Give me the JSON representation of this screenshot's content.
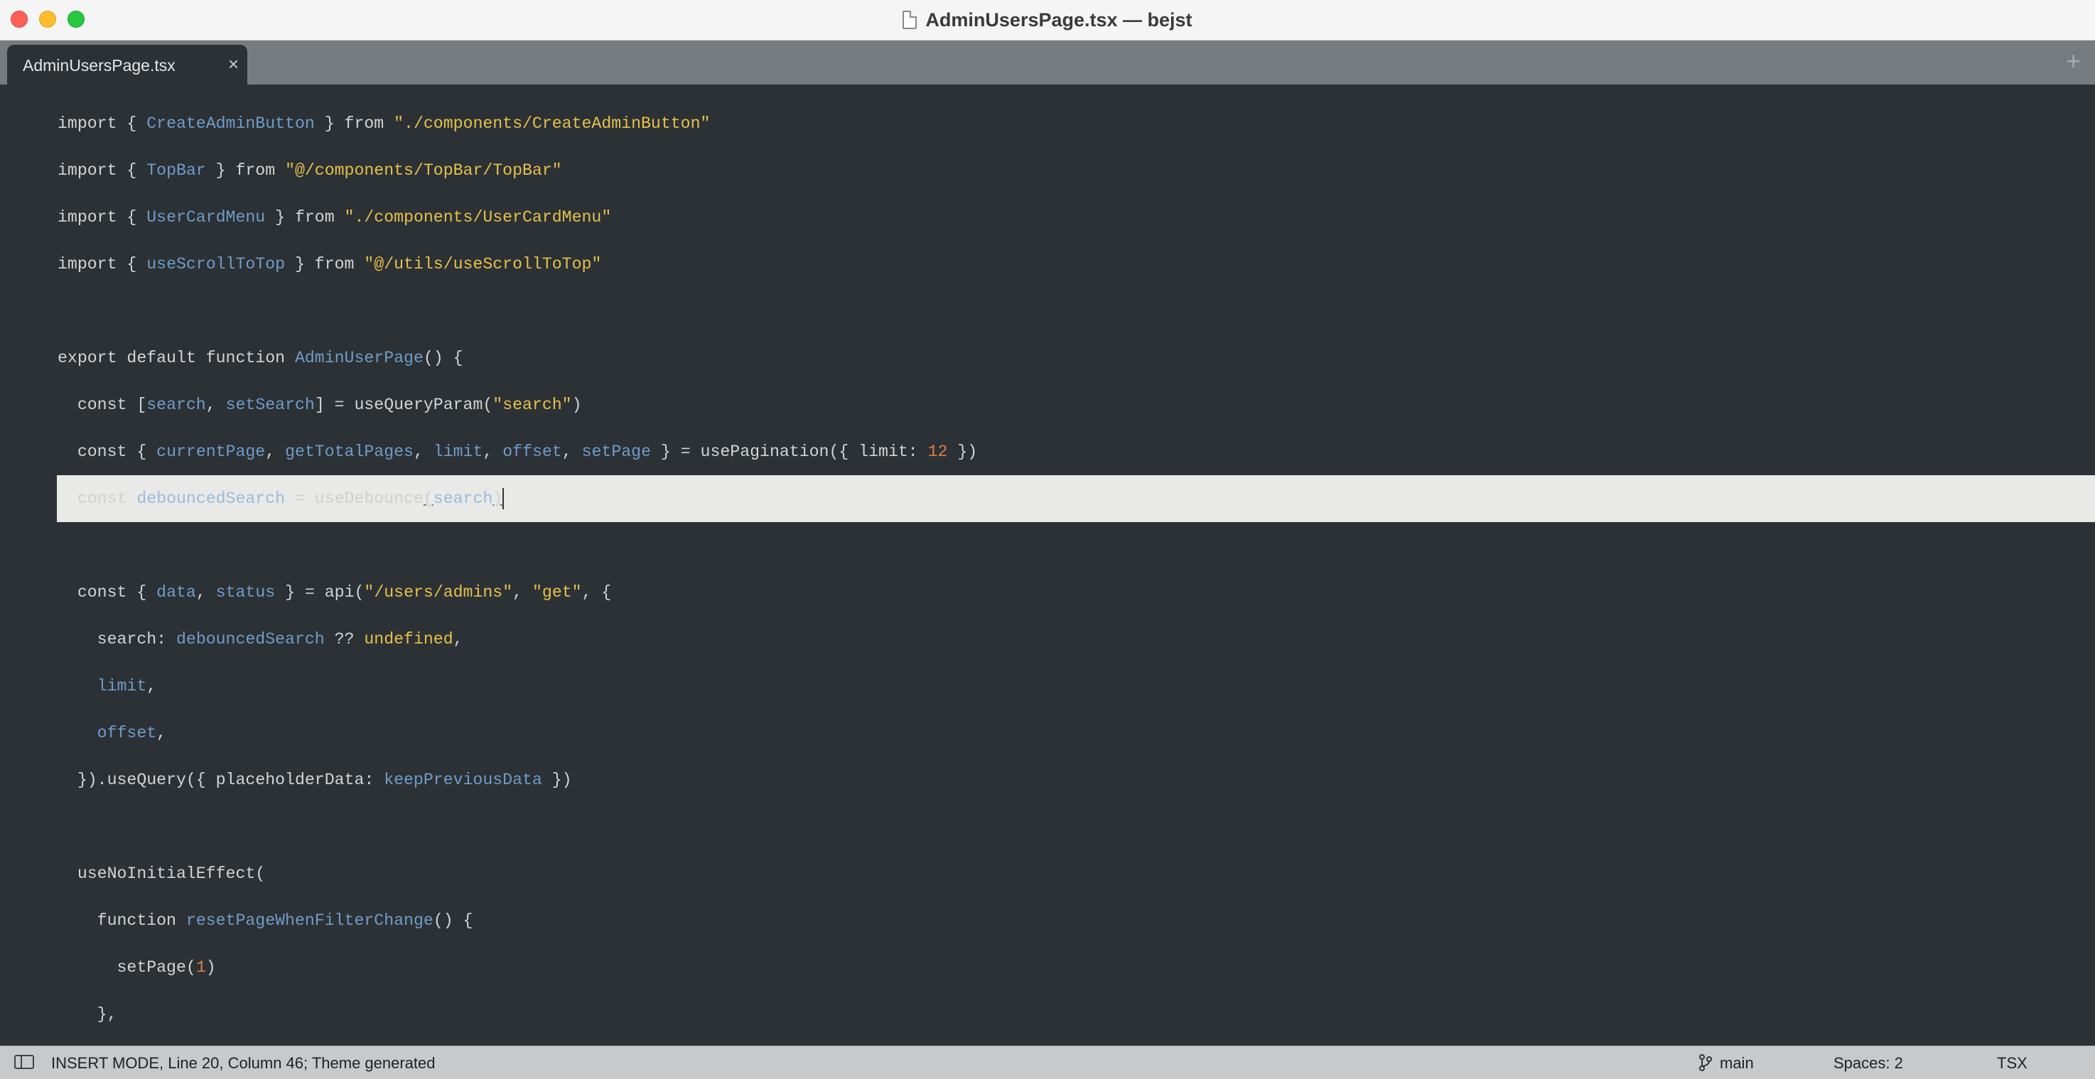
{
  "window": {
    "title": "AdminUsersPage.tsx — bejst"
  },
  "tabs": [
    {
      "label": "AdminUsersPage.tsx",
      "close": "×"
    }
  ],
  "tab_add": "+",
  "editor": {
    "lines": [
      {
        "kind": "code",
        "tokens": [
          {
            "t": "import { ",
            "c": "plain"
          },
          {
            "t": "CreateAdminButton",
            "c": "ident"
          },
          {
            "t": " } from ",
            "c": "plain"
          },
          {
            "t": "\"./components/CreateAdminButton\"",
            "c": "str"
          }
        ]
      },
      {
        "kind": "code",
        "tokens": [
          {
            "t": "import { ",
            "c": "plain"
          },
          {
            "t": "TopBar",
            "c": "ident"
          },
          {
            "t": " } from ",
            "c": "plain"
          },
          {
            "t": "\"@/components/TopBar/TopBar\"",
            "c": "str"
          }
        ]
      },
      {
        "kind": "code",
        "tokens": [
          {
            "t": "import { ",
            "c": "plain"
          },
          {
            "t": "UserCardMenu",
            "c": "ident"
          },
          {
            "t": " } from ",
            "c": "plain"
          },
          {
            "t": "\"./components/UserCardMenu\"",
            "c": "str"
          }
        ]
      },
      {
        "kind": "code",
        "tokens": [
          {
            "t": "import { ",
            "c": "plain"
          },
          {
            "t": "useScrollToTop",
            "c": "ident"
          },
          {
            "t": " } from ",
            "c": "plain"
          },
          {
            "t": "\"@/utils/useScrollToTop\"",
            "c": "str"
          }
        ]
      },
      {
        "kind": "blank",
        "tokens": []
      },
      {
        "kind": "code",
        "tokens": [
          {
            "t": "export default function ",
            "c": "plain"
          },
          {
            "t": "AdminUserPage",
            "c": "ident"
          },
          {
            "t": "() {",
            "c": "plain"
          }
        ]
      },
      {
        "kind": "code",
        "tokens": [
          {
            "t": "  const [",
            "c": "plain"
          },
          {
            "t": "search",
            "c": "ident"
          },
          {
            "t": ", ",
            "c": "plain"
          },
          {
            "t": "setSearch",
            "c": "ident"
          },
          {
            "t": "] = useQueryParam(",
            "c": "plain"
          },
          {
            "t": "\"search\"",
            "c": "str"
          },
          {
            "t": ")",
            "c": "plain"
          }
        ]
      },
      {
        "kind": "code",
        "tokens": [
          {
            "t": "  const { ",
            "c": "plain"
          },
          {
            "t": "currentPage",
            "c": "ident"
          },
          {
            "t": ", ",
            "c": "plain"
          },
          {
            "t": "getTotalPages",
            "c": "ident"
          },
          {
            "t": ", ",
            "c": "plain"
          },
          {
            "t": "limit",
            "c": "ident"
          },
          {
            "t": ", ",
            "c": "plain"
          },
          {
            "t": "offset",
            "c": "ident"
          },
          {
            "t": ", ",
            "c": "plain"
          },
          {
            "t": "setPage",
            "c": "ident"
          },
          {
            "t": " } = usePagination({ limit: ",
            "c": "plain"
          },
          {
            "t": "12",
            "c": "num"
          },
          {
            "t": " })",
            "c": "plain"
          }
        ]
      },
      {
        "kind": "current",
        "tokens": [
          {
            "t": "  const ",
            "c": "cur-kw"
          },
          {
            "t": "debouncedSearch",
            "c": "cur-id"
          },
          {
            "t": " = useDebounce",
            "c": "cur-kw"
          },
          {
            "t": "(",
            "c": "cur-kw ul"
          },
          {
            "t": "search",
            "c": "cur-id"
          },
          {
            "t": ")",
            "c": "cur-kw ul"
          }
        ]
      },
      {
        "kind": "blank",
        "tokens": []
      },
      {
        "kind": "code",
        "tokens": [
          {
            "t": "  const { ",
            "c": "plain"
          },
          {
            "t": "data",
            "c": "ident"
          },
          {
            "t": ", ",
            "c": "plain"
          },
          {
            "t": "status",
            "c": "ident"
          },
          {
            "t": " } = api(",
            "c": "plain"
          },
          {
            "t": "\"/users/admins\"",
            "c": "str"
          },
          {
            "t": ", ",
            "c": "plain"
          },
          {
            "t": "\"get\"",
            "c": "str"
          },
          {
            "t": ", {",
            "c": "plain"
          }
        ]
      },
      {
        "kind": "code",
        "tokens": [
          {
            "t": "    search: ",
            "c": "plain"
          },
          {
            "t": "debouncedSearch",
            "c": "ident"
          },
          {
            "t": " ?? ",
            "c": "plain"
          },
          {
            "t": "undefined",
            "c": "str"
          },
          {
            "t": ",",
            "c": "plain"
          }
        ]
      },
      {
        "kind": "code",
        "tokens": [
          {
            "t": "    ",
            "c": "plain"
          },
          {
            "t": "limit",
            "c": "ident"
          },
          {
            "t": ",",
            "c": "plain"
          }
        ]
      },
      {
        "kind": "code",
        "tokens": [
          {
            "t": "    ",
            "c": "plain"
          },
          {
            "t": "offset",
            "c": "ident"
          },
          {
            "t": ",",
            "c": "plain"
          }
        ]
      },
      {
        "kind": "code",
        "tokens": [
          {
            "t": "  }).useQuery({ placeholderData: ",
            "c": "plain"
          },
          {
            "t": "keepPreviousData",
            "c": "ident"
          },
          {
            "t": " })",
            "c": "plain"
          }
        ]
      },
      {
        "kind": "blank",
        "tokens": []
      },
      {
        "kind": "code",
        "tokens": [
          {
            "t": "  useNoInitialEffect(",
            "c": "plain"
          }
        ]
      },
      {
        "kind": "code",
        "tokens": [
          {
            "t": "    function ",
            "c": "plain"
          },
          {
            "t": "resetPageWhenFilterChange",
            "c": "ident"
          },
          {
            "t": "() {",
            "c": "plain"
          }
        ]
      },
      {
        "kind": "code",
        "tokens": [
          {
            "t": "      setPage(",
            "c": "plain"
          },
          {
            "t": "1",
            "c": "num"
          },
          {
            "t": ")",
            "c": "plain"
          }
        ]
      },
      {
        "kind": "code",
        "tokens": [
          {
            "t": "    },",
            "c": "plain"
          }
        ]
      }
    ]
  },
  "statusbar": {
    "mode": "INSERT MODE, Line 20, Column 46; Theme generated",
    "branch": "main",
    "spaces": "Spaces: 2",
    "syntax": "TSX"
  },
  "colors": {
    "editor_bg": "#2c3135",
    "identifier": "#6f9cc9",
    "string": "#e5c04a",
    "number": "#e0803e",
    "current_line_bg": "#e9e9e7"
  }
}
